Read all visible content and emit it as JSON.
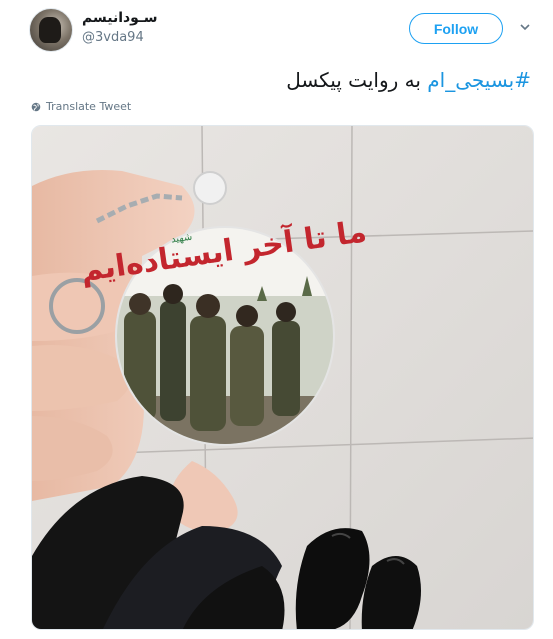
{
  "tweet": {
    "display_name": "سـودانیسم",
    "handle": "@3vda94",
    "follow_label": "Follow",
    "hashtag": "#بسیجی_ام",
    "text_rest": " به روایت پیکسل",
    "translate_label": "Translate Tweet"
  },
  "photo": {
    "badge_caption": "ما تا آخر ایستاده‌ایم",
    "badge_small_caption": "شهید"
  },
  "icons": {
    "more": "chevron-down-icon",
    "translate": "globe-icon"
  },
  "colors": {
    "accent": "#1da1f2",
    "hashtag": "#1b95e0",
    "secondary_text": "#657786"
  }
}
